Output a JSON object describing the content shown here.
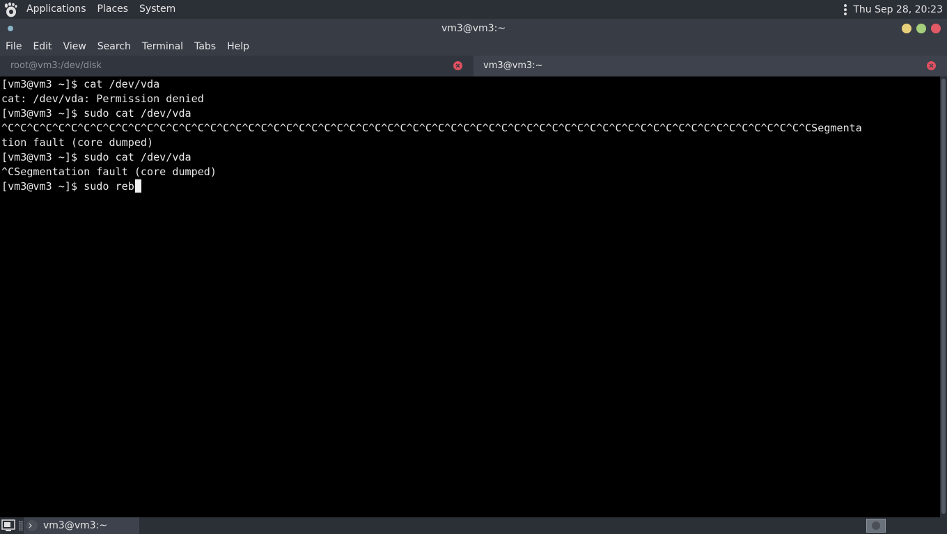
{
  "top_panel": {
    "menus": [
      "Applications",
      "Places",
      "System"
    ],
    "clock": "Thu Sep 28, 20:23",
    "logo_icon": "gnome-foot-icon"
  },
  "window": {
    "title": "vm3@vm3:~",
    "buttons": {
      "minimize_color": "#e8cf7a",
      "maximize_color": "#a6cf7b",
      "close_color": "#e35a67"
    }
  },
  "menu_bar": {
    "items": [
      "File",
      "Edit",
      "View",
      "Search",
      "Terminal",
      "Tabs",
      "Help"
    ]
  },
  "tabs": [
    {
      "label": "root@vm3:/dev/disk",
      "active": false
    },
    {
      "label": "vm3@vm3:~",
      "active": true
    }
  ],
  "terminal": {
    "lines": [
      "[vm3@vm3 ~]$ cat /dev/vda",
      "cat: /dev/vda: Permission denied",
      "[vm3@vm3 ~]$ sudo cat /dev/vda",
      "^C^C^C^C^C^C^C^C^C^C^C^C^C^C^C^C^C^C^C^C^C^C^C^C^C^C^C^C^C^C^C^C^C^C^C^C^C^C^C^C^C^C^C^C^C^C^C^C^C^C^C^C^C^C^C^C^C^C^C^C^C^C^C^CSegmenta",
      "tion fault (core dumped)",
      "[vm3@vm3 ~]$ sudo cat /dev/vda",
      "^CSegmentation fault (core dumped)"
    ],
    "current_line": "[vm3@vm3 ~]$ sudo reb"
  },
  "taskbar": {
    "window_button": "vm3@vm3:~"
  }
}
